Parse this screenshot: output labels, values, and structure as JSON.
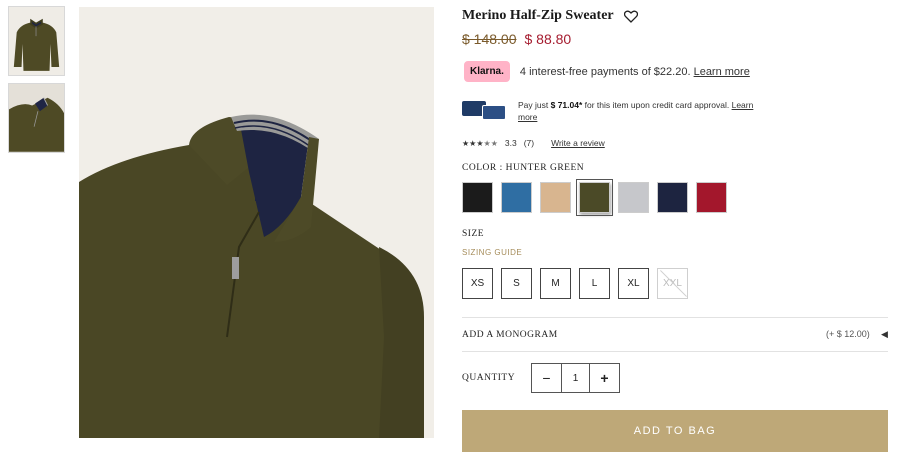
{
  "product": {
    "title": "Merino Half-Zip Sweater",
    "original_price": "$ 148.00",
    "sale_price": "$ 88.80"
  },
  "klarna": {
    "badge": "Klarna.",
    "text": "4 interest-free payments of $22.20.",
    "link": "Learn more"
  },
  "credit": {
    "prefix": "Pay just ",
    "amount": "$ 71.04*",
    "suffix": " for this item upon credit card approval.",
    "link": "Learn more"
  },
  "rating": {
    "score": "3.3",
    "count": "(7)",
    "stars_filled": 3.3,
    "stars_total": 5,
    "write_review": "Write a review"
  },
  "color": {
    "label": "COLOR :  HUNTER GREEN",
    "swatches": [
      {
        "name": "black",
        "hex": "#1b1b1b"
      },
      {
        "name": "blue",
        "hex": "#2f6ea3"
      },
      {
        "name": "camel",
        "hex": "#d8b58f"
      },
      {
        "name": "hunter green",
        "hex": "#4b4a27",
        "selected": true
      },
      {
        "name": "light grey",
        "hex": "#c6c7cb"
      },
      {
        "name": "navy",
        "hex": "#1d2440"
      },
      {
        "name": "red",
        "hex": "#a3172c"
      }
    ]
  },
  "size": {
    "label": "SIZE",
    "guide": "SIZING GUIDE",
    "options": [
      {
        "label": "XS",
        "available": true
      },
      {
        "label": "S",
        "available": true
      },
      {
        "label": "M",
        "available": true
      },
      {
        "label": "L",
        "available": true
      },
      {
        "label": "XL",
        "available": true
      },
      {
        "label": "XXL",
        "available": false
      }
    ]
  },
  "monogram": {
    "label": "ADD A MONOGRAM",
    "price": "(+ $ 12.00)"
  },
  "quantity": {
    "label": "QUANTITY",
    "minus": "−",
    "value": "1",
    "plus": "+"
  },
  "cta": {
    "add_to_bag": "ADD TO BAG"
  },
  "colors": {
    "accent": "#bea878",
    "sale": "#a51c2f",
    "original_price": "#7a5a2b",
    "sizing_guide": "#a58c5a"
  }
}
